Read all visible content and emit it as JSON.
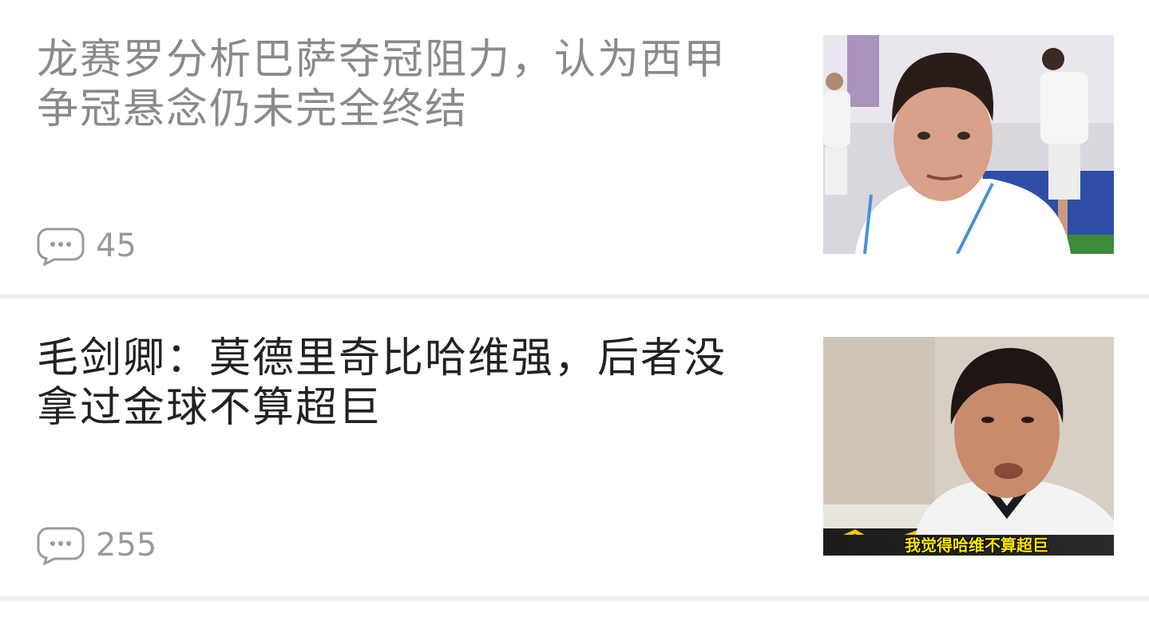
{
  "feed": {
    "items": [
      {
        "title": "龙赛罗分析巴萨夺冠阻力，认为西甲争冠悬念仍未完全终结",
        "comment_count": "45",
        "thumbnail_icon": "photo-man-stadium",
        "read": true
      },
      {
        "title": "毛剑卿：莫德里奇比哈维强，后者没拿过金球不算超巨",
        "comment_count": "255",
        "thumbnail_icon": "photo-man-video",
        "thumbnail_caption": "我觉得哈维不算超巨",
        "read": false
      }
    ]
  },
  "colors": {
    "read_title": "#8a8a8a",
    "unread_title": "#222222",
    "meta": "#9a9a9a",
    "divider": "#f0f0f0",
    "caption": "#ffe600"
  }
}
